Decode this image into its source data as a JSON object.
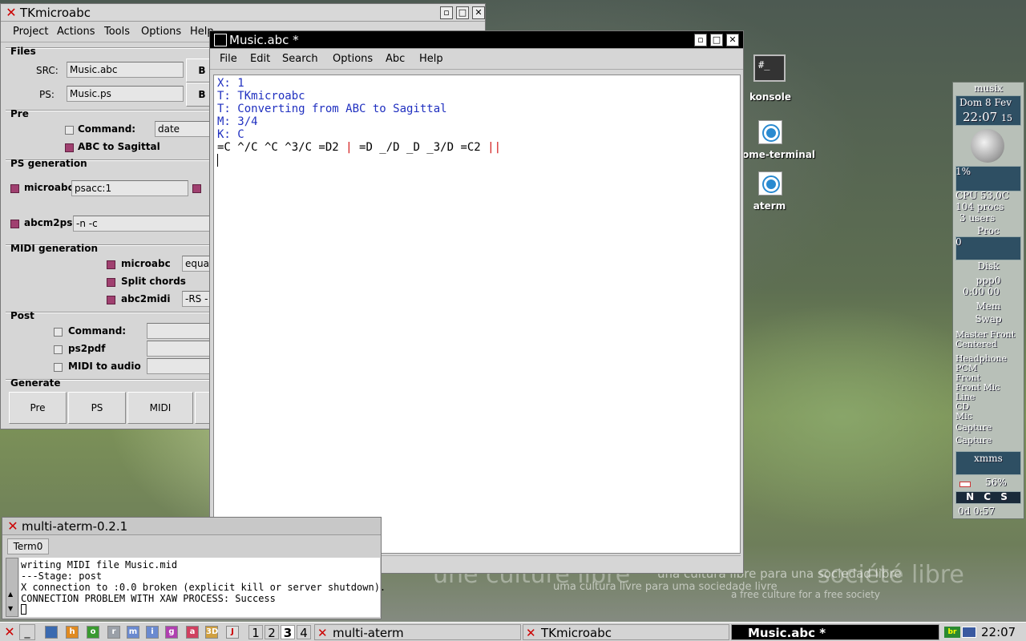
{
  "desktop": {
    "watermark": {
      "es": "una cultura libre para una sociedad libre",
      "pt": "uma cultura livre para uma sociedade livre",
      "en": "a free culture for a free society",
      "fr": "une culture libre",
      "fr2": "société libre"
    },
    "icons": [
      {
        "label": "konsole"
      },
      {
        "label": "ome-terminal"
      },
      {
        "label": "aterm"
      }
    ]
  },
  "tkwindow": {
    "title": "TKmicroabc",
    "menu": [
      "Project",
      "Actions",
      "Tools",
      "Options",
      "Help"
    ],
    "files": {
      "section": "Files",
      "src_label": "SRC:",
      "src_value": "Music.abc",
      "ps_label": "PS:",
      "ps_value": "Music.ps",
      "browse_label": "B"
    },
    "pre": {
      "section": "Pre",
      "command_label": "Command:",
      "command_value": "date",
      "abc_to_sagittal": "ABC to Sagittal"
    },
    "psgen": {
      "section": "PS generation",
      "microabc_label": "microabc",
      "microabc_value": "psacc:1",
      "abcm2ps_label": "abcm2ps",
      "abcm2ps_value": "-n -c"
    },
    "midigen": {
      "section": "MIDI generation",
      "microabc_label": "microabc",
      "microabc_value": "equa",
      "split_chords": "Split chords",
      "abc2midi_label": "abc2midi",
      "abc2midi_value": "-RS -"
    },
    "post": {
      "section": "Post",
      "command_label": "Command:",
      "ps2pdf_label": "ps2pdf",
      "midi_audio_label": "MIDI to audio"
    },
    "generate": {
      "section": "Generate",
      "buttons": [
        "Pre",
        "PS",
        "MIDI"
      ]
    }
  },
  "editor": {
    "title": "Music.abc *",
    "menu": [
      "File",
      "Edit",
      "Search",
      "Options",
      "Abc",
      "Help"
    ],
    "lines": {
      "l1": "X: 1",
      "l2": "T: TKmicroabc",
      "l3": "T: Converting from ABC to Sagittal",
      "l4": "M: 3/4",
      "l5": "K: C",
      "l6a": "=C ^/C ^C ^3/C =D2 ",
      "l6b": "|",
      "l6c": " =D _/D _D _3/D =C2 ",
      "l6d": "||"
    }
  },
  "terminal": {
    "title": "multi-aterm-0.2.1",
    "tab": "Term0",
    "lines": [
      "writing MIDI file Music.mid",
      "---Stage: post",
      "X connection to :0.0 broken (explicit kill or server shutdown).",
      "CONNECTION PROBLEM WITH XAW PROCESS: Success"
    ]
  },
  "monitor": {
    "host": "musix",
    "date": "Dom  8 Fev",
    "time": "22:07",
    "seconds": "15",
    "cpu_pct": "1%",
    "cpu_label": "CPU",
    "cpu_temp": "53,0C",
    "procs": "104 procs",
    "users": "3 users",
    "proc_label": "Proc",
    "proc_value": "0",
    "disk_label": "Disk",
    "net_iface": "ppp0",
    "net_time": "0:00 00",
    "mem_label": "Mem",
    "swap_label": "Swap",
    "mixer": [
      "Master Front",
      "Centered",
      "Headphone",
      "PCM",
      "Front",
      "Front Mic",
      "Line",
      "CD",
      "Mic",
      "Capture",
      "Capture"
    ],
    "player": "xmms",
    "battery": "56%",
    "locks": "N C S",
    "uptime": "0d 0:57"
  },
  "taskbar": {
    "workspaces": [
      "1",
      "2",
      "3",
      "4"
    ],
    "current_workspace": "3",
    "quick_icons": [
      "h",
      "o",
      "r",
      "m",
      "i",
      "g",
      "a",
      "3D",
      "J"
    ],
    "tasks": [
      "multi-aterm",
      "TKmicroabc",
      "Music.abc *"
    ],
    "clock": "22:07",
    "tray_flag": "br"
  }
}
